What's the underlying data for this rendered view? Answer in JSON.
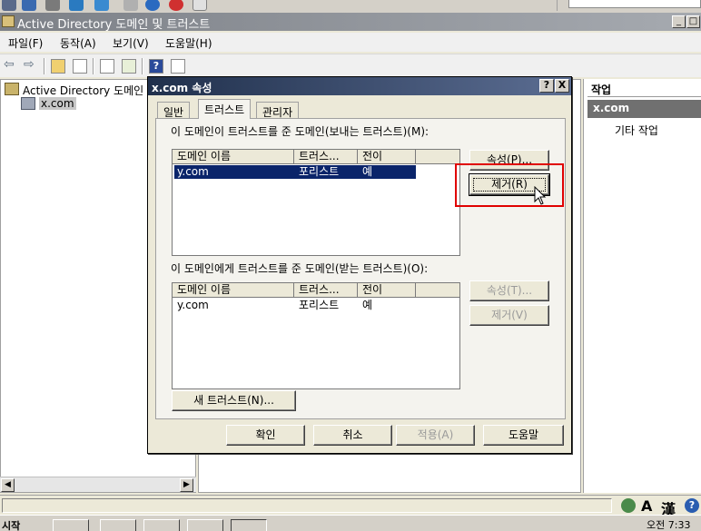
{
  "window": {
    "title": "Active Directory 도메인 및 트러스트"
  },
  "menu": [
    "파일(F)",
    "동작(A)",
    "보기(V)",
    "도움말(H)"
  ],
  "tree": {
    "root": "Active Directory 도메인 및 트러스트",
    "child": "x.com"
  },
  "actions": {
    "header": "작업",
    "selected": "x.com",
    "more": "기타 작업"
  },
  "dialog": {
    "title": "x.com 속성",
    "help_button": "?",
    "close_button": "X",
    "tabs": [
      "일반",
      "트러스트",
      "관리자"
    ],
    "outgoing": {
      "label": "이 도메인이 트러스트를 준 도메인(보내는 트러스트)(M):",
      "columns": [
        "도메인 이름",
        "트러스...",
        "전이"
      ],
      "rows": [
        {
          "domain": "y.com",
          "type": "포리스트",
          "transitive": "예"
        }
      ],
      "properties_button": "속성(P)...",
      "remove_button": "제거(R)"
    },
    "incoming": {
      "label": "이 도메인에게 트러스트를 준 도메인(받는 트러스트)(O):",
      "columns": [
        "도메인 이름",
        "트러스...",
        "전이"
      ],
      "rows": [
        {
          "domain": "y.com",
          "type": "포리스트",
          "transitive": "예"
        }
      ],
      "properties_button": "속성(T)...",
      "remove_button": "제거(V)"
    },
    "new_trust_button": "새 트러스트(N)...",
    "ok_button": "확인",
    "cancel_button": "취소",
    "apply_button": "적용(A)",
    "help_text_button": "도움말"
  },
  "status": {
    "ime_mode": "A",
    "ime_hanja": "漢",
    "ime_help": "?"
  },
  "taskbar": {
    "start": "시작",
    "clock": "오전 7:33"
  },
  "colors": {
    "dialog_title": "#20304c",
    "selection": "#0a246a",
    "highlight": "#e00000"
  }
}
